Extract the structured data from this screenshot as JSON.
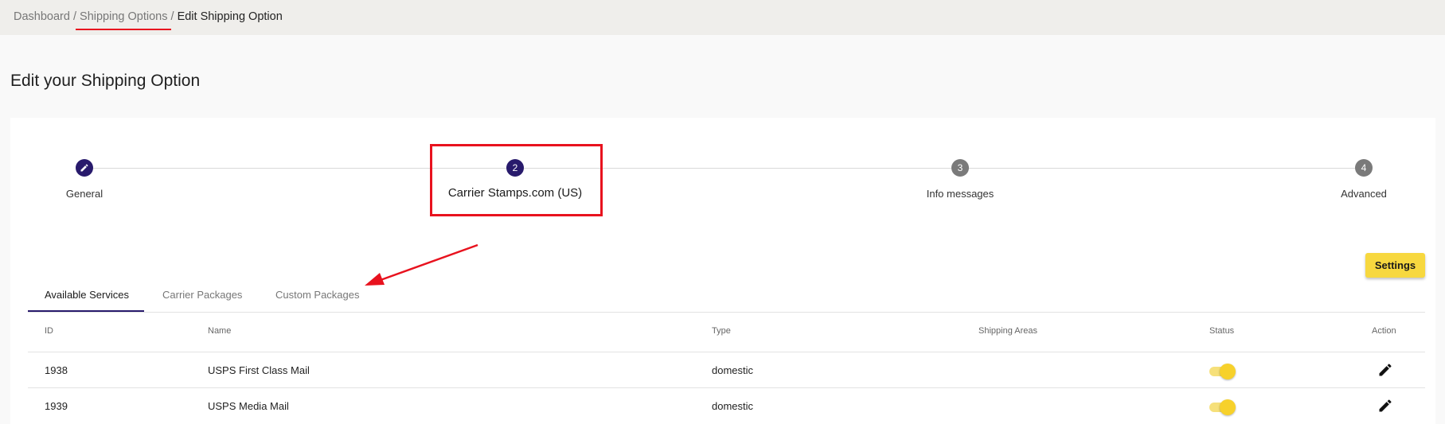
{
  "breadcrumb": {
    "items": [
      "Dashboard",
      "Shipping Options"
    ],
    "separator": " / ",
    "current": "Edit Shipping Option"
  },
  "page": {
    "title": "Edit your Shipping Option"
  },
  "stepper": {
    "steps": [
      {
        "number": "",
        "label": "General",
        "state": "completed",
        "icon": "pencil-icon"
      },
      {
        "number": "2",
        "label": "Carrier Stamps.com (US)",
        "state": "active"
      },
      {
        "number": "3",
        "label": "Info messages",
        "state": "inactive"
      },
      {
        "number": "4",
        "label": "Advanced",
        "state": "inactive"
      }
    ]
  },
  "toolbar": {
    "settings_label": "Settings"
  },
  "tabs": [
    {
      "label": "Available Services",
      "active": true
    },
    {
      "label": "Carrier Packages",
      "active": false
    },
    {
      "label": "Custom Packages",
      "active": false
    }
  ],
  "table": {
    "headers": [
      "ID",
      "Name",
      "Type",
      "Shipping Areas",
      "Status",
      "Action"
    ],
    "rows": [
      {
        "id": "1938",
        "name": "USPS First Class Mail",
        "type": "domestic",
        "areas": "",
        "status": true,
        "action": "edit-icon"
      },
      {
        "id": "1939",
        "name": "USPS Media Mail",
        "type": "domestic",
        "areas": "",
        "status": true,
        "action": "edit-icon"
      }
    ]
  },
  "colors": {
    "accent": "#281a6c",
    "button": "#f7d83f",
    "annotation": "#e8121e",
    "toggle": "#f7d12b"
  }
}
